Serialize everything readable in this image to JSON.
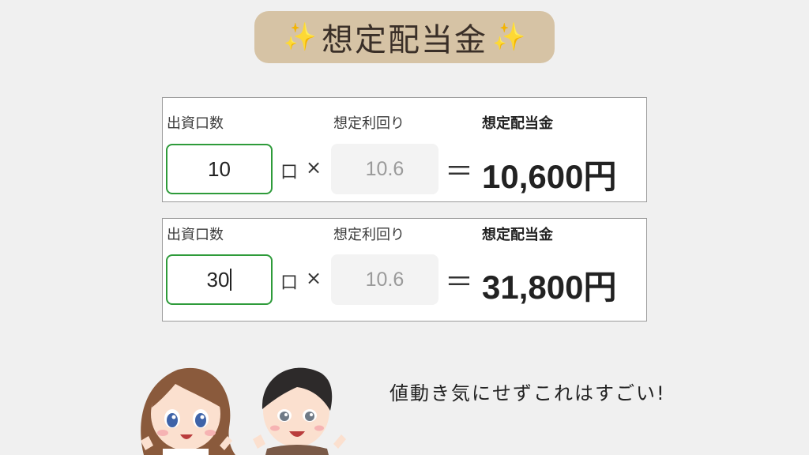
{
  "title": {
    "text": "想定配当金",
    "sparkle_left": "✨",
    "sparkle_right": "✨",
    "background": "#d6c3a5"
  },
  "calculators": [
    {
      "units_label": "出資口数",
      "yield_label": "想定利回り",
      "dividend_label": "想定配当金",
      "units_value": "10",
      "unit_suffix": "口",
      "times": "×",
      "yield_value": "10.6",
      "equals": "＝",
      "result": "10,600円"
    },
    {
      "units_label": "出資口数",
      "yield_label": "想定利回り",
      "dividend_label": "想定配当金",
      "units_value": "30",
      "unit_suffix": "口",
      "times": "×",
      "yield_value": "10.6",
      "equals": "＝",
      "result": "31,800円"
    }
  ],
  "comment": "値動き気にせずこれはすごい!",
  "colors": {
    "accent_green": "#2e9b3a",
    "background": "#f0f0f0"
  }
}
